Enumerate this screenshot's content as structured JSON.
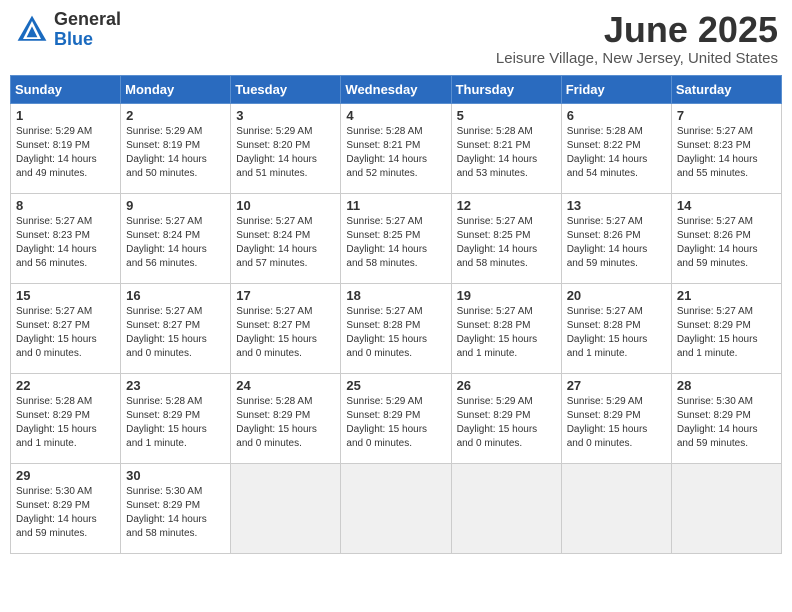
{
  "header": {
    "logo_general": "General",
    "logo_blue": "Blue",
    "month_title": "June 2025",
    "location": "Leisure Village, New Jersey, United States"
  },
  "weekdays": [
    "Sunday",
    "Monday",
    "Tuesday",
    "Wednesday",
    "Thursday",
    "Friday",
    "Saturday"
  ],
  "weeks": [
    [
      {
        "day": "1",
        "info": "Sunrise: 5:29 AM\nSunset: 8:19 PM\nDaylight: 14 hours\nand 49 minutes."
      },
      {
        "day": "2",
        "info": "Sunrise: 5:29 AM\nSunset: 8:19 PM\nDaylight: 14 hours\nand 50 minutes."
      },
      {
        "day": "3",
        "info": "Sunrise: 5:29 AM\nSunset: 8:20 PM\nDaylight: 14 hours\nand 51 minutes."
      },
      {
        "day": "4",
        "info": "Sunrise: 5:28 AM\nSunset: 8:21 PM\nDaylight: 14 hours\nand 52 minutes."
      },
      {
        "day": "5",
        "info": "Sunrise: 5:28 AM\nSunset: 8:21 PM\nDaylight: 14 hours\nand 53 minutes."
      },
      {
        "day": "6",
        "info": "Sunrise: 5:28 AM\nSunset: 8:22 PM\nDaylight: 14 hours\nand 54 minutes."
      },
      {
        "day": "7",
        "info": "Sunrise: 5:27 AM\nSunset: 8:23 PM\nDaylight: 14 hours\nand 55 minutes."
      }
    ],
    [
      {
        "day": "8",
        "info": "Sunrise: 5:27 AM\nSunset: 8:23 PM\nDaylight: 14 hours\nand 56 minutes."
      },
      {
        "day": "9",
        "info": "Sunrise: 5:27 AM\nSunset: 8:24 PM\nDaylight: 14 hours\nand 56 minutes."
      },
      {
        "day": "10",
        "info": "Sunrise: 5:27 AM\nSunset: 8:24 PM\nDaylight: 14 hours\nand 57 minutes."
      },
      {
        "day": "11",
        "info": "Sunrise: 5:27 AM\nSunset: 8:25 PM\nDaylight: 14 hours\nand 58 minutes."
      },
      {
        "day": "12",
        "info": "Sunrise: 5:27 AM\nSunset: 8:25 PM\nDaylight: 14 hours\nand 58 minutes."
      },
      {
        "day": "13",
        "info": "Sunrise: 5:27 AM\nSunset: 8:26 PM\nDaylight: 14 hours\nand 59 minutes."
      },
      {
        "day": "14",
        "info": "Sunrise: 5:27 AM\nSunset: 8:26 PM\nDaylight: 14 hours\nand 59 minutes."
      }
    ],
    [
      {
        "day": "15",
        "info": "Sunrise: 5:27 AM\nSunset: 8:27 PM\nDaylight: 15 hours\nand 0 minutes."
      },
      {
        "day": "16",
        "info": "Sunrise: 5:27 AM\nSunset: 8:27 PM\nDaylight: 15 hours\nand 0 minutes."
      },
      {
        "day": "17",
        "info": "Sunrise: 5:27 AM\nSunset: 8:27 PM\nDaylight: 15 hours\nand 0 minutes."
      },
      {
        "day": "18",
        "info": "Sunrise: 5:27 AM\nSunset: 8:28 PM\nDaylight: 15 hours\nand 0 minutes."
      },
      {
        "day": "19",
        "info": "Sunrise: 5:27 AM\nSunset: 8:28 PM\nDaylight: 15 hours\nand 1 minute."
      },
      {
        "day": "20",
        "info": "Sunrise: 5:27 AM\nSunset: 8:28 PM\nDaylight: 15 hours\nand 1 minute."
      },
      {
        "day": "21",
        "info": "Sunrise: 5:27 AM\nSunset: 8:29 PM\nDaylight: 15 hours\nand 1 minute."
      }
    ],
    [
      {
        "day": "22",
        "info": "Sunrise: 5:28 AM\nSunset: 8:29 PM\nDaylight: 15 hours\nand 1 minute."
      },
      {
        "day": "23",
        "info": "Sunrise: 5:28 AM\nSunset: 8:29 PM\nDaylight: 15 hours\nand 1 minute."
      },
      {
        "day": "24",
        "info": "Sunrise: 5:28 AM\nSunset: 8:29 PM\nDaylight: 15 hours\nand 0 minutes."
      },
      {
        "day": "25",
        "info": "Sunrise: 5:29 AM\nSunset: 8:29 PM\nDaylight: 15 hours\nand 0 minutes."
      },
      {
        "day": "26",
        "info": "Sunrise: 5:29 AM\nSunset: 8:29 PM\nDaylight: 15 hours\nand 0 minutes."
      },
      {
        "day": "27",
        "info": "Sunrise: 5:29 AM\nSunset: 8:29 PM\nDaylight: 15 hours\nand 0 minutes."
      },
      {
        "day": "28",
        "info": "Sunrise: 5:30 AM\nSunset: 8:29 PM\nDaylight: 14 hours\nand 59 minutes."
      }
    ],
    [
      {
        "day": "29",
        "info": "Sunrise: 5:30 AM\nSunset: 8:29 PM\nDaylight: 14 hours\nand 59 minutes."
      },
      {
        "day": "30",
        "info": "Sunrise: 5:30 AM\nSunset: 8:29 PM\nDaylight: 14 hours\nand 58 minutes."
      },
      {
        "day": "",
        "info": ""
      },
      {
        "day": "",
        "info": ""
      },
      {
        "day": "",
        "info": ""
      },
      {
        "day": "",
        "info": ""
      },
      {
        "day": "",
        "info": ""
      }
    ]
  ]
}
